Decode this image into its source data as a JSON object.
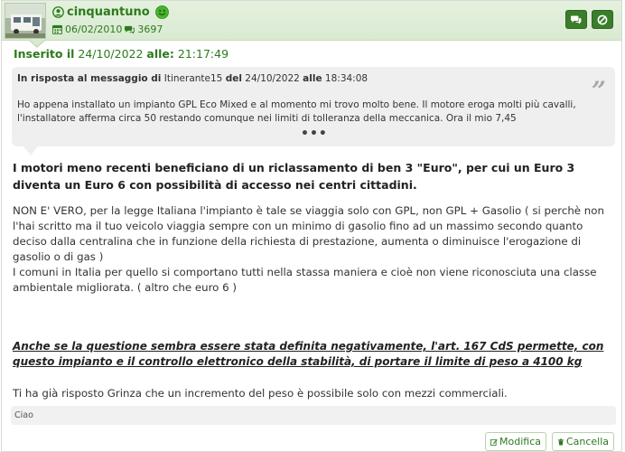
{
  "author": {
    "username": "cinquantuno",
    "registered": "06/02/2010",
    "message_count": "3697",
    "status_color": "#47b52a"
  },
  "header_buttons": {
    "message_icon": "comments-icon",
    "ban_icon": "ban-icon"
  },
  "post": {
    "posted_label": "Inserito il",
    "posted_date": "24/10/2022",
    "posted_time_label": "alle:",
    "posted_time": "21:17:49"
  },
  "quote": {
    "intro": "In risposta al messaggio di",
    "quoted_user": "Itinerante15",
    "date_label": "del",
    "date": "24/10/2022",
    "time_label": "alle",
    "time": "18:34:08",
    "text": "Ho appena installato un impianto GPL Eco Mixed e al momento mi trovo molto bene. Il motore eroga molti più cavalli, l'installatore afferma circa 50 restando comunque nei limiti di tolleranza della meccanica. Ora il mio 7,45",
    "more": "•••",
    "mark": "”"
  },
  "body": {
    "lead": "I motori meno recenti beneficiano di un riclassamento di ben 3 \"Euro\", per cui un Euro 3 diventa un Euro 6 con possibilità di accesso nei centri cittadini.",
    "paragraph": "NON E' VERO, per la legge Italiana l'impianto è tale se viaggia solo con GPL, non GPL + Gasolio ( si perchè non l'hai scritto ma il tuo veicolo viaggia sempre con un minimo di gasolio fino ad un massimo secondo quanto deciso dalla centralina che in funzione della richiesta di prestazione, aumenta o diminuisce l'erogazione di gasolio o di gas )",
    "paragraph2": "I comuni in Italia per quello si comportano tutti nella stassa maniera e cioè non viene riconosciuta una classe ambientale migliorata. ( altro che euro 6 )",
    "underlined": "Anche se la questione sembra essere stata definita negativamente, l'art. 167 CdS permette, con questo impianto e il controllo elettronico della stabilità, di portare il limite di peso a 4100 kg",
    "reply": "Ti ha già risposto Grinza che un incremento del peso è possibile solo con mezzi commerciali."
  },
  "signature": "Ciao",
  "footer": {
    "edit_label": "Modifica",
    "delete_label": "Cancella"
  },
  "colors": {
    "accent": "#2d7a1c",
    "header_bg": "#d9ead2",
    "button_bg": "#3a7d2a",
    "quote_bg": "#efefef"
  }
}
